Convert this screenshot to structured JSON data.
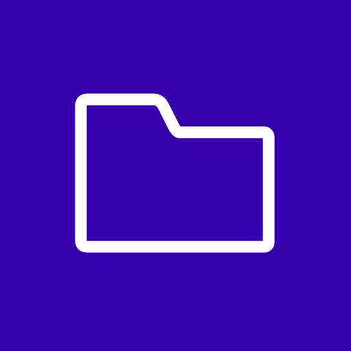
{
  "icon": {
    "name": "folder-icon",
    "background_color": "#3700AD",
    "stroke_color": "#FFFFFF"
  }
}
